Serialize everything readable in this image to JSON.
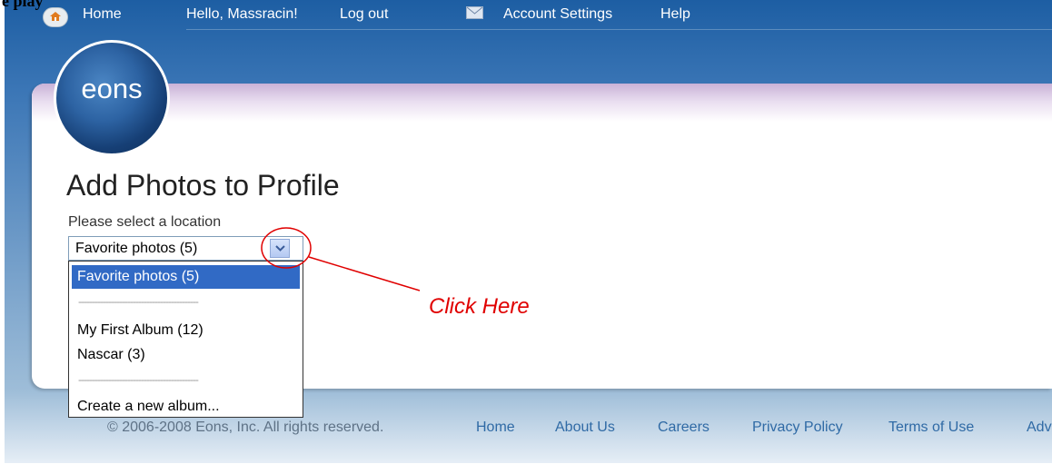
{
  "top_clip_text": "e  play",
  "nav": {
    "home_label": "Home",
    "greeting": "Hello, Massracin!",
    "logout_label": "Log out",
    "account_settings_label": "Account Settings",
    "help_label": "Help",
    "home_icon": "home-icon",
    "mail_icon": "envelope-icon"
  },
  "logo": {
    "text": "eons"
  },
  "page": {
    "title": "Add Photos to Profile",
    "select_label": "Please select a location",
    "selected_value": "Favorite photos (5)"
  },
  "dropdown": {
    "options": [
      "Favorite photos (5)",
      "My First Album (12)",
      "Nascar (3)",
      "Create a new album..."
    ],
    "separator": "--------------------------------------------"
  },
  "annotation": {
    "text": "Click Here",
    "color": "#e00000"
  },
  "footer": {
    "copyright": "© 2006-2008 Eons, Inc. All rights reserved.",
    "links": [
      "Home",
      "About Us",
      "Careers",
      "Privacy Policy",
      "Terms of Use",
      "Adv"
    ]
  },
  "colors": {
    "brand_blue": "#1d5ea3",
    "selection_blue": "#316ac5",
    "footer_link": "#2f6aa5"
  }
}
